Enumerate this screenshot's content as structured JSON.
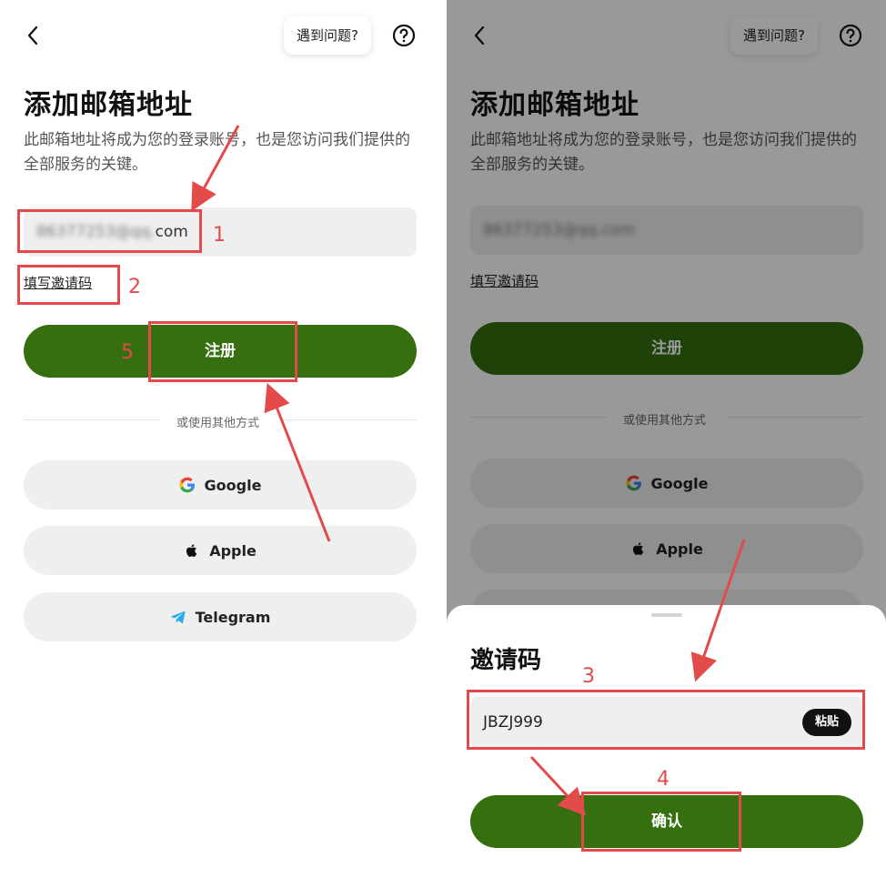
{
  "header": {
    "help_label": "遇到问题?"
  },
  "register_page": {
    "title": "添加邮箱地址",
    "description": "此邮箱地址将成为您的登录账号，也是您访问我们提供的全部服务的关键。",
    "email_value_visible": "com",
    "email_blurred": "86377253@qq.",
    "invite_link": "填写邀请码",
    "register_button": "注册",
    "divider_text": "或使用其他方式",
    "social": {
      "google": "Google",
      "apple": "Apple",
      "telegram": "Telegram"
    }
  },
  "invite_sheet": {
    "title": "邀请码",
    "code_value": "JBZJ999",
    "paste_button": "粘贴",
    "confirm_button": "确认"
  },
  "annotations": {
    "step1": "1",
    "step2": "2",
    "step3": "3",
    "step4": "4",
    "step5": "5"
  },
  "colors": {
    "primary": "#356f0f",
    "primary_dimmed": "#1f3f0a",
    "annotation": "#e34b4b",
    "field_bg": "#efefef"
  }
}
